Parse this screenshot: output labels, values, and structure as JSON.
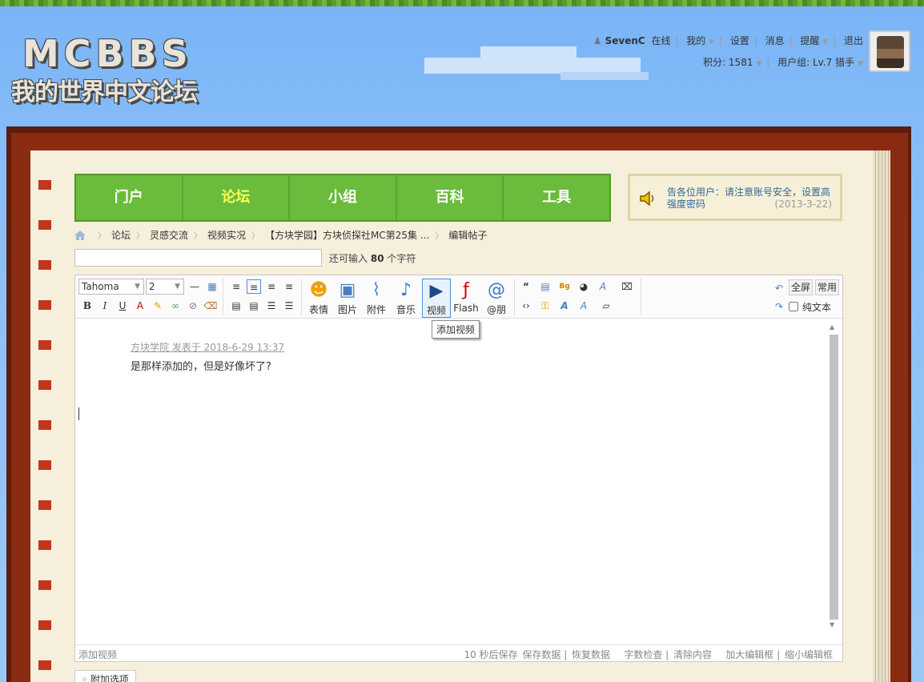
{
  "logo": {
    "top": "MCBBS",
    "bottom": "我的世界中文论坛"
  },
  "user": {
    "name": "SevenC",
    "status": "在线",
    "mine": "我的",
    "settings": "设置",
    "messages": "消息",
    "reminders": "提醒",
    "logout": "退出",
    "points": "积分: 1581",
    "group": "用户组: Lv.7 猎手"
  },
  "nav": {
    "items": [
      "门户",
      "论坛",
      "小组",
      "百科",
      "工具"
    ],
    "active_index": 1
  },
  "notice": {
    "text": "告各位用户：请注意账号安全，设置高强度密码",
    "date": "(2013-3-22)"
  },
  "breadcrumb": [
    "论坛",
    "灵感交流",
    "视频实况",
    "【方块学园】方块侦探社MC第25集 ...",
    "编辑帖子"
  ],
  "subject": {
    "value": "",
    "counter_prefix": "还可输入",
    "counter_value": "80",
    "counter_suffix": "个字符"
  },
  "toolbar": {
    "font": "Tahoma",
    "size": "2",
    "big_buttons": [
      {
        "label": "表情",
        "icon": "smiley-icon"
      },
      {
        "label": "图片",
        "icon": "image-icon"
      },
      {
        "label": "附件",
        "icon": "paperclip-icon"
      },
      {
        "label": "音乐",
        "icon": "music-icon"
      },
      {
        "label": "视频",
        "icon": "video-icon"
      },
      {
        "label": "Flash",
        "icon": "flash-icon"
      },
      {
        "label": "@朋",
        "icon": "at-icon"
      }
    ],
    "fullscreen": "全屏",
    "common": "常用",
    "plaintext": "纯文本",
    "tooltip": "添加视频"
  },
  "content": {
    "quote_author": "方块学院 发表于 2018-6-29 13:37",
    "quote_text": "是那样添加的，但是好像坏了?"
  },
  "statusbar": {
    "left": "添加视频",
    "autosave": "10 秒后保存",
    "save": "保存数据",
    "restore": "恢复数据",
    "wordcheck": "字数检查",
    "clear": "清除内容",
    "enlarge": "加大编辑框",
    "shrink": "缩小编辑框"
  },
  "extra_options": "附加选项",
  "colors": {
    "nav_green": "#6bbb3c",
    "nav_active": "#ffff55",
    "book_red": "#8a2c12",
    "page": "#f5efdc"
  }
}
